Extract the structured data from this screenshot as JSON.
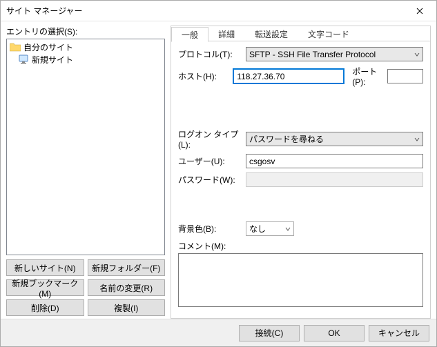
{
  "window": {
    "title": "サイト マネージャー"
  },
  "left": {
    "entry_label": "エントリの選択(S):",
    "tree": {
      "root": "自分のサイト",
      "items": [
        "新規サイト"
      ]
    },
    "buttons": {
      "new_site": "新しいサイト(N)",
      "new_folder": "新規フォルダー(F)",
      "new_bookmark": "新規ブックマーク(M)",
      "rename": "名前の変更(R)",
      "delete": "削除(D)",
      "duplicate": "複製(I)"
    }
  },
  "tabs": {
    "general": "一般",
    "advanced": "詳細",
    "transfer": "転送設定",
    "charset": "文字コード"
  },
  "form": {
    "protocol_label": "プロトコル(T):",
    "protocol_value": "SFTP - SSH File Transfer Protocol",
    "host_label": "ホスト(H):",
    "host_value": "118.27.36.70",
    "port_label": "ポート(P):",
    "port_value": "",
    "logon_label": "ログオン タイプ(L):",
    "logon_value": "パスワードを尋ねる",
    "user_label": "ユーザー(U):",
    "user_value": "csgosv",
    "password_label": "パスワード(W):",
    "password_value": "",
    "bgcolor_label": "背景色(B):",
    "bgcolor_value": "なし",
    "comment_label": "コメント(M):",
    "comment_value": ""
  },
  "footer": {
    "connect": "接続(C)",
    "ok": "OK",
    "cancel": "キャンセル"
  }
}
